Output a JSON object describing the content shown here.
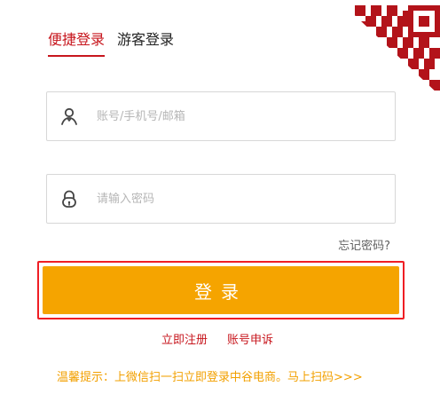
{
  "tabs": [
    {
      "label": "便捷登录",
      "active": true
    },
    {
      "label": "游客登录",
      "active": false
    }
  ],
  "fields": {
    "username_placeholder": "账号/手机号/邮箱",
    "password_placeholder": "请输入密码"
  },
  "icons": {
    "user": "user-icon",
    "password": "lock-icon",
    "qr": "qr-code-icon"
  },
  "forgot_label": "忘记密码?",
  "login_button_label": "登录",
  "links": {
    "register": "立即注册",
    "appeal": "账号申诉"
  },
  "tip": {
    "prefix": "温馨提示：",
    "message": "上微信扫一扫立即登录中谷电商。",
    "scan_action": "马上扫码>>>"
  },
  "colors": {
    "accent_red": "#c7161d",
    "button_orange": "#f5a400",
    "highlight_border": "#ef1e24",
    "tip_orange": "#f2a000"
  }
}
